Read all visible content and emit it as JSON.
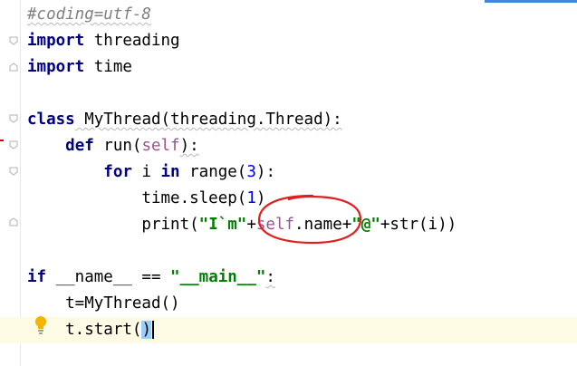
{
  "editor": {
    "language": "python",
    "lines": [
      {
        "tokens": [
          {
            "t": "#coding=utf-8",
            "c": "cmt"
          }
        ]
      },
      {
        "tokens": [
          {
            "t": "import",
            "c": "kw"
          },
          {
            "t": " threading",
            "c": "plain"
          }
        ]
      },
      {
        "tokens": [
          {
            "t": "import",
            "c": "kw"
          },
          {
            "t": " time",
            "c": "plain"
          }
        ]
      },
      {
        "tokens": []
      },
      {
        "tokens": [
          {
            "t": "class",
            "c": "kw"
          },
          {
            "t": " MyThread(threading.Thread):",
            "c": "plain"
          }
        ]
      },
      {
        "tokens": [
          {
            "t": "    ",
            "c": "plain"
          },
          {
            "t": "def",
            "c": "kw"
          },
          {
            "t": " run(",
            "c": "plain"
          },
          {
            "t": "self",
            "c": "self"
          },
          {
            "t": "):",
            "c": "plain"
          }
        ]
      },
      {
        "tokens": [
          {
            "t": "        ",
            "c": "plain"
          },
          {
            "t": "for",
            "c": "kw"
          },
          {
            "t": " i ",
            "c": "plain"
          },
          {
            "t": "in",
            "c": "kw"
          },
          {
            "t": " range(",
            "c": "plain"
          },
          {
            "t": "3",
            "c": "num"
          },
          {
            "t": "):",
            "c": "plain"
          }
        ]
      },
      {
        "tokens": [
          {
            "t": "            time.sleep(",
            "c": "plain"
          },
          {
            "t": "1",
            "c": "num"
          },
          {
            "t": ")",
            "c": "plain"
          }
        ]
      },
      {
        "tokens": [
          {
            "t": "            print(",
            "c": "plain"
          },
          {
            "t": "\"I`m\"",
            "c": "str"
          },
          {
            "t": "+",
            "c": "plain"
          },
          {
            "t": "self",
            "c": "self"
          },
          {
            "t": ".name+",
            "c": "plain"
          },
          {
            "t": "\"@\"",
            "c": "str"
          },
          {
            "t": "+str(i))",
            "c": "plain"
          }
        ]
      },
      {
        "tokens": []
      },
      {
        "tokens": [
          {
            "t": "if",
            "c": "kw"
          },
          {
            "t": " __name__ == ",
            "c": "plain"
          },
          {
            "t": "\"__main__\"",
            "c": "str"
          },
          {
            "t": ":",
            "c": "plain"
          }
        ]
      },
      {
        "tokens": [
          {
            "t": "    t=MyThread()",
            "c": "plain"
          }
        ]
      },
      {
        "tokens": [
          {
            "t": "    t.start(",
            "c": "plain"
          },
          {
            "t": ")",
            "c": "paren-hl"
          }
        ]
      }
    ]
  },
  "colors": {
    "keyword": "#000080",
    "comment": "#808080",
    "number": "#0000ff",
    "string": "#008000",
    "self": "#94558d",
    "current_line": "#fdfbe3",
    "annotation": "#e02020"
  },
  "icons": [
    "fold-marker-icon",
    "lightbulb-icon",
    "annotation-circle"
  ]
}
